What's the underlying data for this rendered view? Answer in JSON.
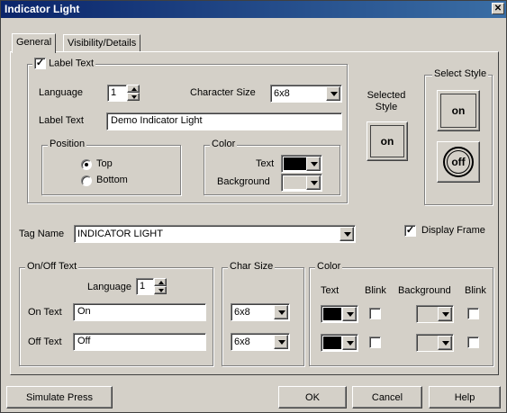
{
  "window": {
    "title": "Indicator Light",
    "close_glyph": "✕"
  },
  "tabs": [
    {
      "label": "General",
      "active": true
    },
    {
      "label": "Visibility/Details",
      "active": false
    }
  ],
  "label_text_group": {
    "checkbox_label": "Label Text",
    "checked": true,
    "language_label": "Language",
    "language_value": "1",
    "char_size_label": "Character Size",
    "char_size_value": "6x8",
    "label_text_label": "Label Text",
    "label_text_value": "Demo Indicator Light",
    "position": {
      "title": "Position",
      "options": [
        "Top",
        "Bottom"
      ],
      "selected": "Top"
    },
    "color": {
      "title": "Color",
      "text_label": "Text",
      "text_color": "#000000",
      "background_label": "Background",
      "background_color": "#d4d0c8"
    }
  },
  "selected_style": {
    "label": "Selected Style",
    "button_text": "on"
  },
  "select_style": {
    "title": "Select Style",
    "options": [
      "on",
      "off"
    ]
  },
  "tag_name": {
    "label": "Tag Name",
    "value": "INDICATOR LIGHT"
  },
  "display_frame": {
    "label": "Display Frame",
    "checked": true
  },
  "onoff_text": {
    "title": "On/Off Text",
    "language_label": "Language",
    "language_value": "1",
    "on_label": "On Text",
    "on_value": "On",
    "off_label": "Off Text",
    "off_value": "Off"
  },
  "char_size": {
    "title": "Char Size",
    "on_value": "6x8",
    "off_value": "6x8"
  },
  "color_group": {
    "title": "Color",
    "headers": [
      "Text",
      "Blink",
      "Background",
      "Blink"
    ],
    "rows": [
      {
        "text_color": "#000000",
        "blink": false,
        "bg_color": "#d4d0c8",
        "bg_blink": false
      },
      {
        "text_color": "#000000",
        "blink": false,
        "bg_color": "#d4d0c8",
        "bg_blink": false
      }
    ]
  },
  "footer": {
    "simulate_label": "Simulate Press",
    "ok_label": "OK",
    "cancel_label": "Cancel",
    "help_label": "Help"
  },
  "icons": [
    "close-icon",
    "dropdown-arrow-icon",
    "spin-up-icon",
    "spin-down-icon",
    "checkmark-icon"
  ]
}
